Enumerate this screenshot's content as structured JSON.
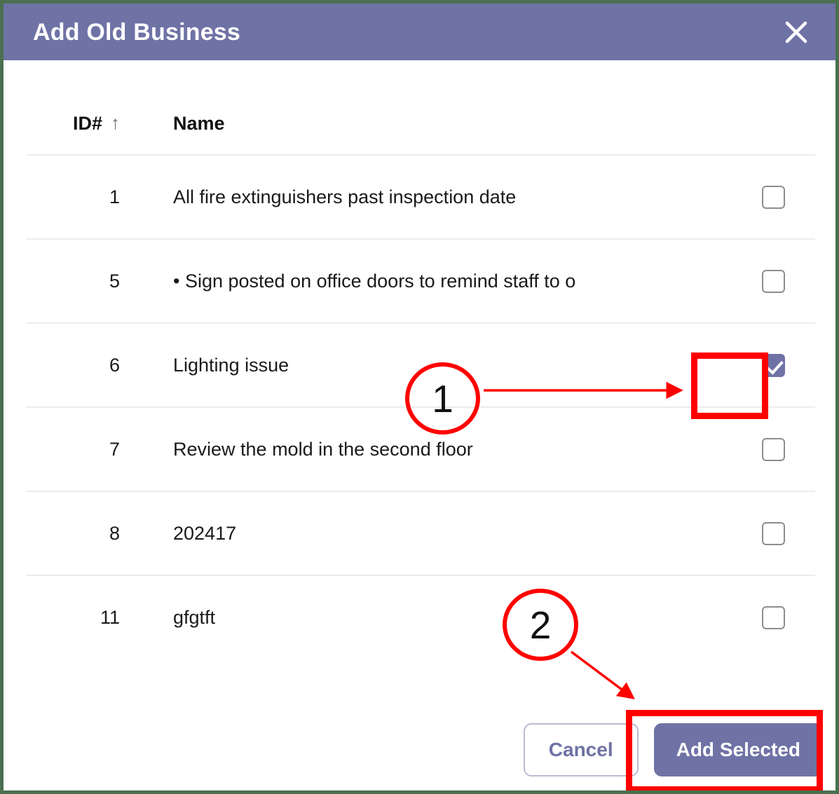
{
  "dialog": {
    "title": "Add Old Business",
    "close_icon": "close-icon"
  },
  "table": {
    "headers": {
      "id": "ID#",
      "sort_indicator": "↑",
      "name": "Name"
    },
    "rows": [
      {
        "id": "1",
        "name": "All fire extinguishers past inspection date",
        "checked": false
      },
      {
        "id": "5",
        "name": "• Sign posted on office doors to remind staff to o",
        "checked": false
      },
      {
        "id": "6",
        "name": "Lighting issue",
        "checked": true
      },
      {
        "id": "7",
        "name": "Review the mold in the second floor",
        "checked": false
      },
      {
        "id": "8",
        "name": "202417",
        "checked": false
      },
      {
        "id": "11",
        "name": "gfgtft",
        "checked": false
      }
    ]
  },
  "footer": {
    "cancel_label": "Cancel",
    "submit_label": "Add Selected"
  },
  "annotations": [
    {
      "number": "1",
      "target": "checkbox-row-6"
    },
    {
      "number": "2",
      "target": "add-selected-button"
    }
  ],
  "colors": {
    "accent": "#6f72a5",
    "annotation": "#ff0000",
    "border": "#4a7050",
    "divider": "#ececec"
  }
}
